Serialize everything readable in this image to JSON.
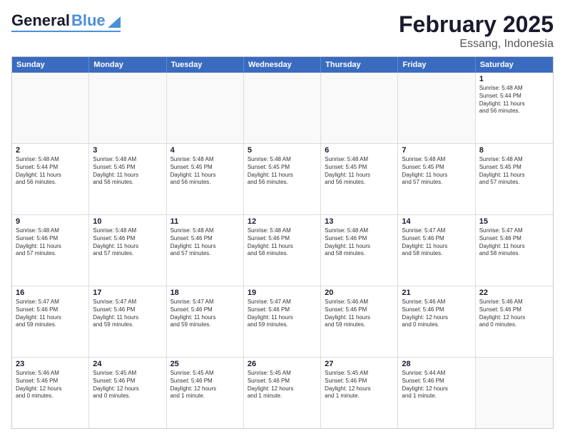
{
  "header": {
    "logo_general": "General",
    "logo_blue": "Blue",
    "title": "February 2025",
    "location": "Essang, Indonesia"
  },
  "calendar": {
    "days": [
      "Sunday",
      "Monday",
      "Tuesday",
      "Wednesday",
      "Thursday",
      "Friday",
      "Saturday"
    ],
    "rows": [
      [
        {
          "day": "",
          "content": ""
        },
        {
          "day": "",
          "content": ""
        },
        {
          "day": "",
          "content": ""
        },
        {
          "day": "",
          "content": ""
        },
        {
          "day": "",
          "content": ""
        },
        {
          "day": "",
          "content": ""
        },
        {
          "day": "1",
          "content": "Sunrise: 5:48 AM\nSunset: 5:44 PM\nDaylight: 11 hours\nand 56 minutes."
        }
      ],
      [
        {
          "day": "2",
          "content": "Sunrise: 5:48 AM\nSunset: 5:44 PM\nDaylight: 11 hours\nand 56 minutes."
        },
        {
          "day": "3",
          "content": "Sunrise: 5:48 AM\nSunset: 5:45 PM\nDaylight: 11 hours\nand 56 minutes."
        },
        {
          "day": "4",
          "content": "Sunrise: 5:48 AM\nSunset: 5:45 PM\nDaylight: 11 hours\nand 56 minutes."
        },
        {
          "day": "5",
          "content": "Sunrise: 5:48 AM\nSunset: 5:45 PM\nDaylight: 11 hours\nand 56 minutes."
        },
        {
          "day": "6",
          "content": "Sunrise: 5:48 AM\nSunset: 5:45 PM\nDaylight: 11 hours\nand 56 minutes."
        },
        {
          "day": "7",
          "content": "Sunrise: 5:48 AM\nSunset: 5:45 PM\nDaylight: 11 hours\nand 57 minutes."
        },
        {
          "day": "8",
          "content": "Sunrise: 5:48 AM\nSunset: 5:45 PM\nDaylight: 11 hours\nand 57 minutes."
        }
      ],
      [
        {
          "day": "9",
          "content": "Sunrise: 5:48 AM\nSunset: 5:46 PM\nDaylight: 11 hours\nand 57 minutes."
        },
        {
          "day": "10",
          "content": "Sunrise: 5:48 AM\nSunset: 5:46 PM\nDaylight: 11 hours\nand 57 minutes."
        },
        {
          "day": "11",
          "content": "Sunrise: 5:48 AM\nSunset: 5:46 PM\nDaylight: 11 hours\nand 57 minutes."
        },
        {
          "day": "12",
          "content": "Sunrise: 5:48 AM\nSunset: 5:46 PM\nDaylight: 11 hours\nand 58 minutes."
        },
        {
          "day": "13",
          "content": "Sunrise: 5:48 AM\nSunset: 5:46 PM\nDaylight: 11 hours\nand 58 minutes."
        },
        {
          "day": "14",
          "content": "Sunrise: 5:47 AM\nSunset: 5:46 PM\nDaylight: 11 hours\nand 58 minutes."
        },
        {
          "day": "15",
          "content": "Sunrise: 5:47 AM\nSunset: 5:46 PM\nDaylight: 11 hours\nand 58 minutes."
        }
      ],
      [
        {
          "day": "16",
          "content": "Sunrise: 5:47 AM\nSunset: 5:46 PM\nDaylight: 11 hours\nand 59 minutes."
        },
        {
          "day": "17",
          "content": "Sunrise: 5:47 AM\nSunset: 5:46 PM\nDaylight: 11 hours\nand 59 minutes."
        },
        {
          "day": "18",
          "content": "Sunrise: 5:47 AM\nSunset: 5:46 PM\nDaylight: 11 hours\nand 59 minutes."
        },
        {
          "day": "19",
          "content": "Sunrise: 5:47 AM\nSunset: 5:46 PM\nDaylight: 11 hours\nand 59 minutes."
        },
        {
          "day": "20",
          "content": "Sunrise: 5:46 AM\nSunset: 5:46 PM\nDaylight: 11 hours\nand 59 minutes."
        },
        {
          "day": "21",
          "content": "Sunrise: 5:46 AM\nSunset: 5:46 PM\nDaylight: 12 hours\nand 0 minutes."
        },
        {
          "day": "22",
          "content": "Sunrise: 5:46 AM\nSunset: 5:46 PM\nDaylight: 12 hours\nand 0 minutes."
        }
      ],
      [
        {
          "day": "23",
          "content": "Sunrise: 5:46 AM\nSunset: 5:46 PM\nDaylight: 12 hours\nand 0 minutes."
        },
        {
          "day": "24",
          "content": "Sunrise: 5:45 AM\nSunset: 5:46 PM\nDaylight: 12 hours\nand 0 minutes."
        },
        {
          "day": "25",
          "content": "Sunrise: 5:45 AM\nSunset: 5:46 PM\nDaylight: 12 hours\nand 1 minute."
        },
        {
          "day": "26",
          "content": "Sunrise: 5:45 AM\nSunset: 5:46 PM\nDaylight: 12 hours\nand 1 minute."
        },
        {
          "day": "27",
          "content": "Sunrise: 5:45 AM\nSunset: 5:46 PM\nDaylight: 12 hours\nand 1 minute."
        },
        {
          "day": "28",
          "content": "Sunrise: 5:44 AM\nSunset: 5:46 PM\nDaylight: 12 hours\nand 1 minute."
        },
        {
          "day": "",
          "content": ""
        }
      ]
    ]
  }
}
